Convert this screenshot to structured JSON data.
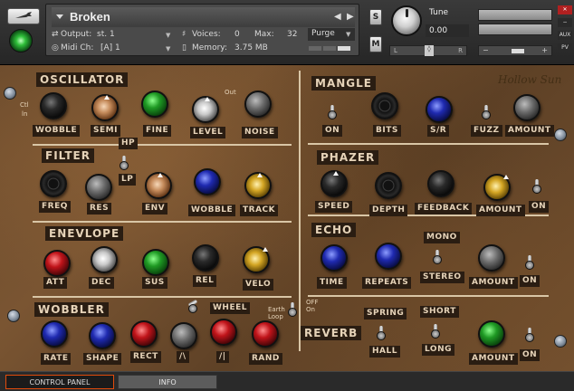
{
  "header": {
    "instrument_name": "Broken",
    "output_label": "Output:",
    "output_value": "st. 1",
    "voices_label": "Voices:",
    "voices_value": "0",
    "max_label": "Max:",
    "max_value": "32",
    "purge_label": "Purge",
    "midi_label": "Midi Ch:",
    "midi_value": "[A] 1",
    "memory_label": "Memory:",
    "memory_value": "3.75 MB",
    "s_label": "S",
    "m_label": "M",
    "tune_label": "Tune",
    "tune_value": "0.00",
    "pan_left": "L",
    "pan_right": "R",
    "vol_minus": "−",
    "vol_plus": "+",
    "aux_label": "AUX",
    "pv_label": "PV"
  },
  "brand": "Hollow Sun",
  "sections": {
    "oscillator": "OSCILLATOR",
    "filter": "FILTER",
    "envelope": "ENEVLOPE",
    "wobbler": "WOBBLER",
    "mangle": "MANGLE",
    "phazer": "PHAZER",
    "echo": "ECHO",
    "reverb": "REVERB"
  },
  "labels": {
    "wobble": "WOBBLE",
    "semi": "SEMI",
    "fine": "FINE",
    "level": "LEVEL",
    "noise": "NOISE",
    "freq": "FREQ",
    "res": "RES",
    "env": "ENV",
    "filter_wobble": "WOBBLE",
    "track": "TRACK",
    "hp": "HP",
    "lp": "LP",
    "att": "ATT",
    "dec": "DEC",
    "sus": "SUS",
    "rel": "REL",
    "velo": "VELO",
    "rate": "RATE",
    "shape": "SHAPE",
    "rect": "RECT",
    "saw_down": "/\\",
    "saw_up": "/|",
    "rand": "RAND",
    "wheel": "WHEEL",
    "mangle_on": "ON",
    "bits": "BITS",
    "sr": "S/R",
    "fuzz": "FUZZ",
    "mangle_amount": "AMOUNT",
    "speed": "SPEED",
    "depth": "DEPTH",
    "feedback": "FEEDBACK",
    "phazer_amount": "AMOUNT",
    "phazer_on": "ON",
    "time": "TIME",
    "repeats": "REPEATS",
    "mono": "MONO",
    "stereo": "STEREO",
    "echo_amount": "AMOUNT",
    "echo_on": "ON",
    "spring": "SPRING",
    "hall": "HALL",
    "short": "SHORT",
    "long": "LONG",
    "reverb_amount": "AMOUNT",
    "reverb_on": "ON",
    "ctl": "Ctl",
    "ln": "ln",
    "out": "Out",
    "earth_loop": "Earth\nLoop",
    "off_on": "OFF\nOn"
  },
  "tabs": {
    "control_panel": "CONTROL PANEL",
    "info": "INFO"
  },
  "colors": {
    "active_tab_border": "#e04b0c",
    "label_bg": "#2a1d12",
    "label_text": "#e6d3b8"
  }
}
